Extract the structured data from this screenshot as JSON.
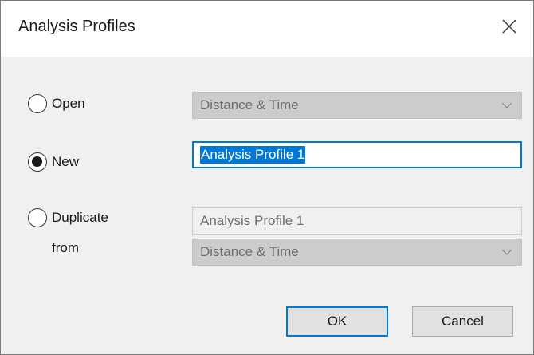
{
  "window": {
    "title": "Analysis Profiles",
    "close_icon": "close-icon"
  },
  "options": {
    "open": {
      "label": "Open",
      "selected": false,
      "dropdown_value": "Distance & Time"
    },
    "new": {
      "label": "New",
      "selected": true,
      "input_value": "Analysis Profile 1"
    },
    "duplicate": {
      "label": "Duplicate",
      "label_line2": "from",
      "selected": false,
      "input_value": "Analysis Profile 1",
      "dropdown_value": "Distance & Time"
    }
  },
  "buttons": {
    "ok_label": "OK",
    "cancel_label": "Cancel"
  },
  "colors": {
    "accent": "#0078d7",
    "dialog_bg": "#f0f0f0",
    "disabled_bg": "#cccccc"
  }
}
